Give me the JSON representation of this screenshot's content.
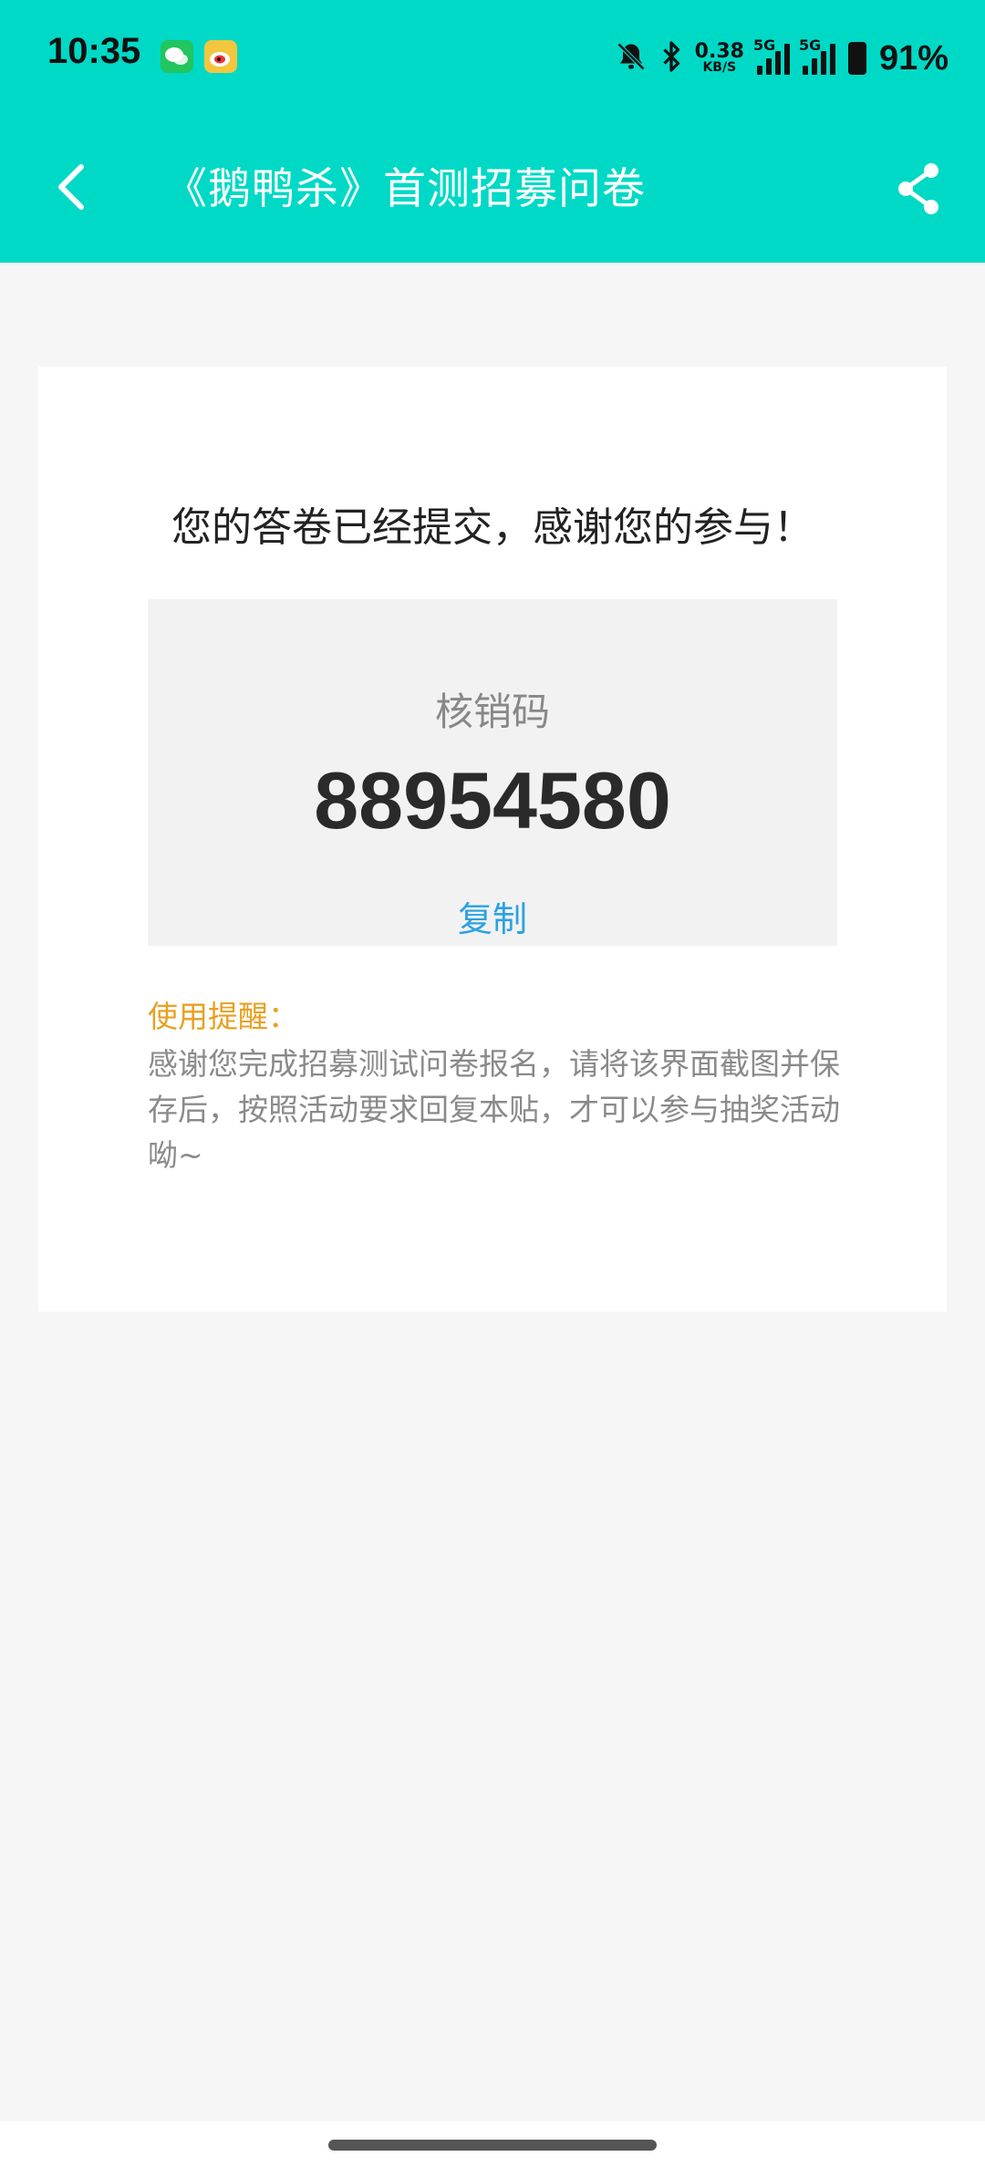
{
  "status_bar": {
    "time": "10:35",
    "app_icons": [
      "wechat-icon",
      "weibo-icon"
    ],
    "net_speed_value": "0.38",
    "net_speed_unit": "KB/S",
    "signal_tag": "5G",
    "battery": "91%"
  },
  "app_bar": {
    "title": "《鹅鸭杀》首测招募问卷",
    "back_icon": "chevron-left-icon",
    "share_icon": "share-icon"
  },
  "card": {
    "success_message": "您的答卷已经提交，感谢您的参与！",
    "code_label": "核销码",
    "code_value": "88954580",
    "copy_label": "复制",
    "tip_title": "使用提醒：",
    "tip_text": "感谢您完成招募测试问卷报名，请将该界面截图并保存后，按照活动要求回复本贴，才可以参与抽奖活动呦~"
  },
  "colors": {
    "header": "#00d9c6",
    "copy_link": "#2aa1e3",
    "tip_title": "#e8a020"
  }
}
